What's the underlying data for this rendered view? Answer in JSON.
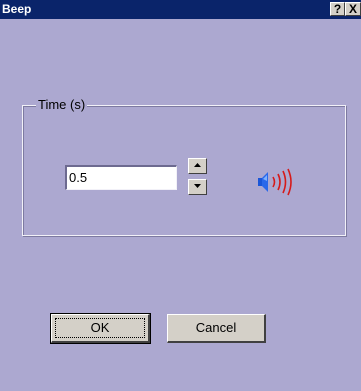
{
  "window": {
    "title": "Beep",
    "help_label": "?",
    "close_label": "X"
  },
  "group": {
    "label": "Time (s)"
  },
  "time_input": {
    "value": "0.5"
  },
  "buttons": {
    "ok_label": "OK",
    "cancel_label": "Cancel"
  },
  "colors": {
    "dialog_background": "#aca8d0",
    "titlebar": "#0a246a",
    "speaker_blue": "#1a56d8",
    "sound_wave_red": "#d61a1a"
  },
  "icons": {
    "speaker": "speaker-icon",
    "spin_up": "arrow-up-icon",
    "spin_down": "arrow-down-icon"
  }
}
